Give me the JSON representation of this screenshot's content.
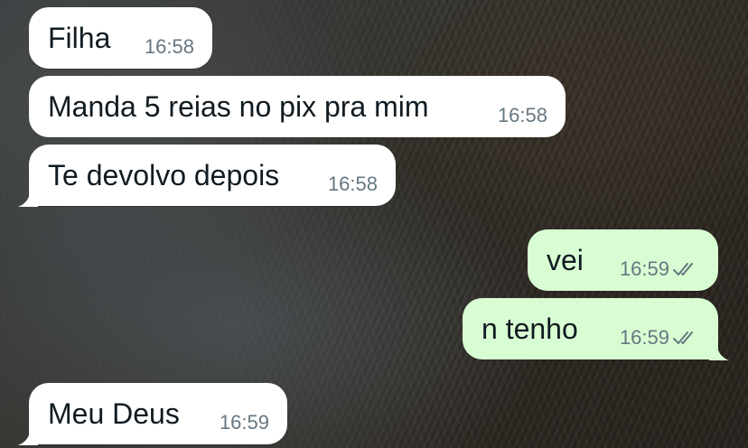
{
  "chat": {
    "messages": [
      {
        "direction": "incoming",
        "text": "Filha",
        "time": "16:58"
      },
      {
        "direction": "incoming",
        "text": "Manda 5 reias no pix pra mim",
        "time": "16:58"
      },
      {
        "direction": "incoming",
        "text": "Te devolvo depois",
        "time": "16:58"
      },
      {
        "direction": "outgoing",
        "text": "vei",
        "time": "16:59",
        "status_icon": "double-check-icon"
      },
      {
        "direction": "outgoing",
        "text": "n tenho",
        "time": "16:59",
        "status_icon": "double-check-icon"
      },
      {
        "direction": "incoming",
        "text": "Meu Deus",
        "time": "16:59"
      }
    ]
  },
  "colors": {
    "incoming_bubble": "#ffffff",
    "outgoing_bubble": "#d9fdd3",
    "message_text": "#111b21",
    "time_text": "#667781"
  }
}
